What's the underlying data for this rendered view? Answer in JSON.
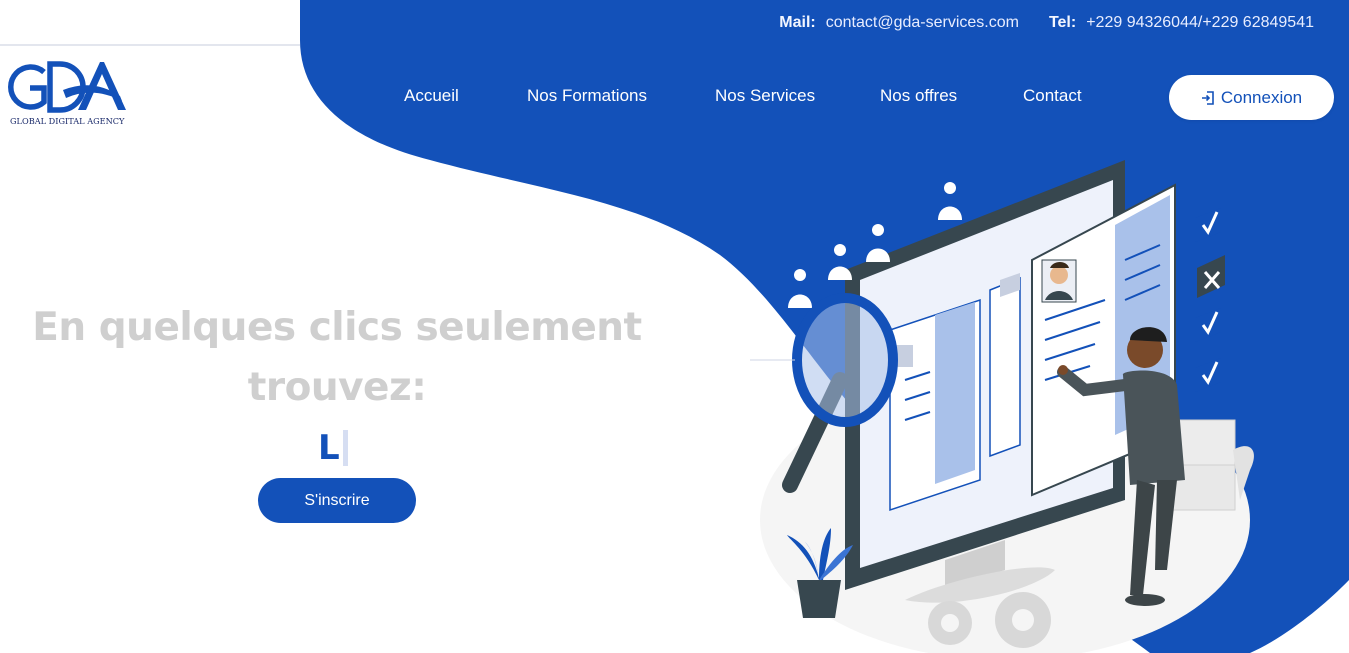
{
  "colors": {
    "brand_blue": "#1351b9",
    "white": "#ffffff",
    "hero_text": "#cfcfcf"
  },
  "logo": {
    "letters": "GDA",
    "tagline": "GLOBAL DIGITAL AGENCY"
  },
  "contact": {
    "mail_label": "Mail:",
    "mail_value": "contact@gda-services.com",
    "tel_label": "Tel:",
    "tel_value": "+229 94326044/+229 62849541"
  },
  "nav": {
    "items": [
      {
        "label": "Accueil"
      },
      {
        "label": "Nos Formations"
      },
      {
        "label": "Nos Services"
      },
      {
        "label": "Nos offres"
      },
      {
        "label": "Contact"
      }
    ],
    "login_label": "Connexion",
    "login_icon": "sign-in-icon"
  },
  "hero": {
    "line1": "En quelques clics seulement",
    "line2": "trouvez:",
    "typed_text": "L",
    "signup_label": "S'inscrire"
  },
  "illustration": {
    "name": "recruitment-search-illustration",
    "check_icons": 3,
    "cross_icons": 1
  }
}
